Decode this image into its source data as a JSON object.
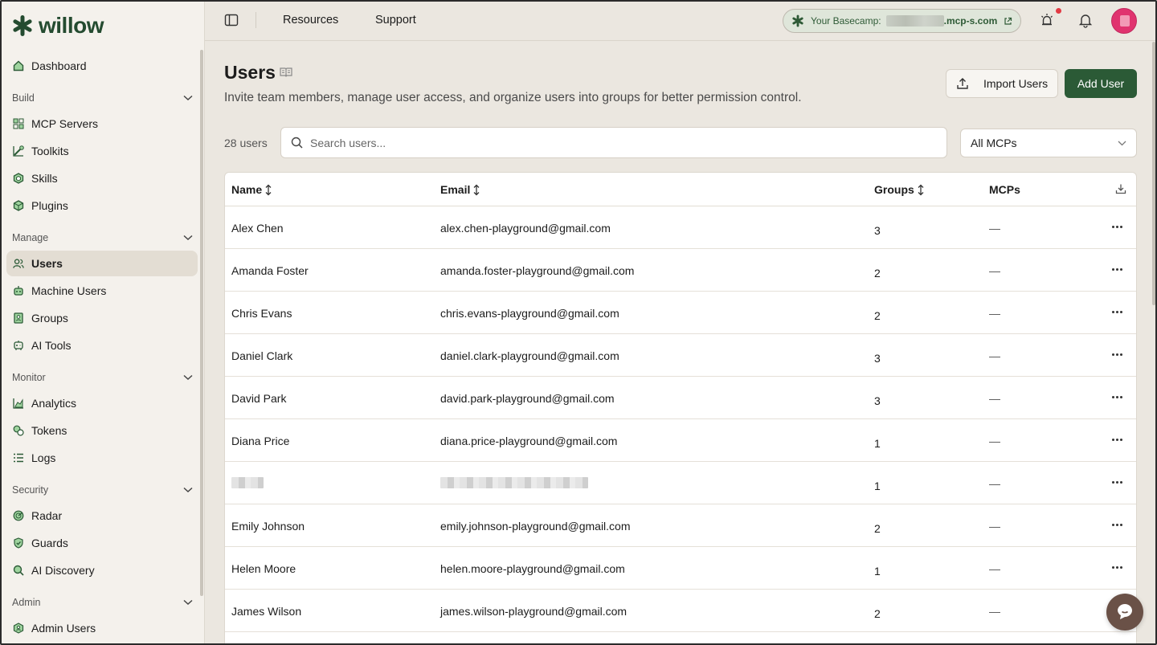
{
  "app": {
    "name": "willow"
  },
  "sidebar": {
    "top_item": {
      "label": "Dashboard",
      "icon": "home-icon"
    },
    "sections": [
      {
        "title": "Build",
        "items": [
          {
            "label": "MCP Servers",
            "icon": "servers-icon"
          },
          {
            "label": "Toolkits",
            "icon": "toolkit-icon"
          },
          {
            "label": "Skills",
            "icon": "hexagon-icon"
          },
          {
            "label": "Plugins",
            "icon": "cube-icon"
          }
        ]
      },
      {
        "title": "Manage",
        "items": [
          {
            "label": "Users",
            "icon": "users-icon",
            "active": true
          },
          {
            "label": "Machine Users",
            "icon": "robot-icon"
          },
          {
            "label": "Groups",
            "icon": "groups-icon"
          },
          {
            "label": "AI Tools",
            "icon": "ai-tools-icon"
          }
        ]
      },
      {
        "title": "Monitor",
        "items": [
          {
            "label": "Analytics",
            "icon": "chart-icon"
          },
          {
            "label": "Tokens",
            "icon": "tokens-icon"
          },
          {
            "label": "Logs",
            "icon": "list-icon"
          }
        ]
      },
      {
        "title": "Security",
        "items": [
          {
            "label": "Radar",
            "icon": "radar-icon"
          },
          {
            "label": "Guards",
            "icon": "shield-icon"
          },
          {
            "label": "AI Discovery",
            "icon": "magnifier-icon"
          }
        ]
      },
      {
        "title": "Admin",
        "items": [
          {
            "label": "Admin Users",
            "icon": "admin-shield-icon"
          }
        ]
      }
    ]
  },
  "topbar": {
    "links": [
      "Resources",
      "Support"
    ],
    "basecamp_label": "Your Basecamp:",
    "basecamp_domain": ".mcp-s.com"
  },
  "page": {
    "title": "Users",
    "subtitle": "Invite team members, manage user access, and organize users into groups for better permission control.",
    "import_label": "Import Users",
    "add_label": "Add User",
    "count_label": "28 users",
    "search_placeholder": "Search users...",
    "filter_value": "All MCPs"
  },
  "table": {
    "headers": {
      "name": "Name",
      "email": "Email",
      "groups": "Groups",
      "mcps": "MCPs"
    },
    "rows": [
      {
        "name": "Alex Chen",
        "email": "alex.chen-playground@gmail.com",
        "groups": "3",
        "mcps": "—"
      },
      {
        "name": "Amanda Foster",
        "email": "amanda.foster-playground@gmail.com",
        "groups": "2",
        "mcps": "—"
      },
      {
        "name": "Chris Evans",
        "email": "chris.evans-playground@gmail.com",
        "groups": "2",
        "mcps": "—"
      },
      {
        "name": "Daniel Clark",
        "email": "daniel.clark-playground@gmail.com",
        "groups": "3",
        "mcps": "—"
      },
      {
        "name": "David Park",
        "email": "david.park-playground@gmail.com",
        "groups": "3",
        "mcps": "—"
      },
      {
        "name": "Diana Price",
        "email": "diana.price-playground@gmail.com",
        "groups": "1",
        "mcps": "—"
      },
      {
        "name": "",
        "email": "",
        "groups": "1",
        "mcps": "—",
        "redacted": true
      },
      {
        "name": "Emily Johnson",
        "email": "emily.johnson-playground@gmail.com",
        "groups": "2",
        "mcps": "—"
      },
      {
        "name": "Helen Moore",
        "email": "helen.moore-playground@gmail.com",
        "groups": "1",
        "mcps": "—"
      },
      {
        "name": "James Wilson",
        "email": "james.wilson-playground@gmail.com",
        "groups": "2",
        "mcps": "—"
      }
    ]
  },
  "colors": {
    "brand": "#244b30",
    "primary_button": "#2b5a36",
    "notification_dot": "#e23a44",
    "avatar": "#e0336f"
  }
}
